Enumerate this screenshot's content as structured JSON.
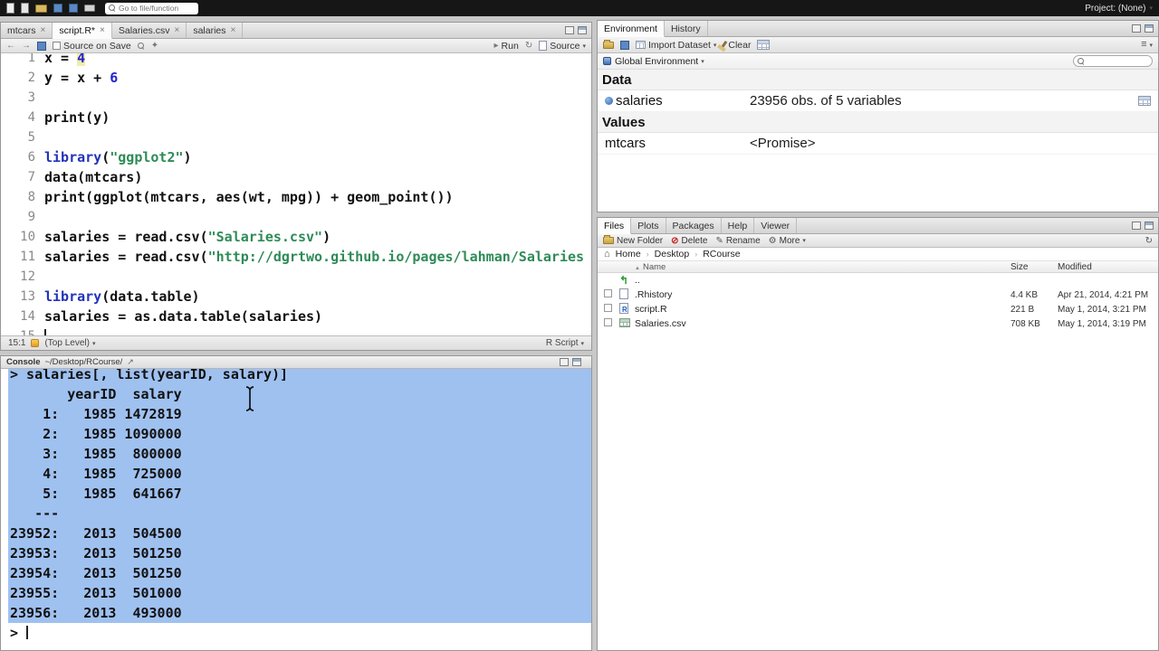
{
  "menubar": {
    "search_placeholder": "Go to file/function",
    "project_label": "Project: (None)"
  },
  "icons": {
    "close": "×",
    "chevron_down": "▾",
    "back_arrow": "←",
    "forward_arrow": "→",
    "run": "▸",
    "rerun": "↻",
    "refresh": "↻",
    "delete": "⊘",
    "rename": "✎",
    "gear": "⚙",
    "home": "⌂",
    "parent_dir": "↰",
    "sort_asc": "▲",
    "popout": "↗",
    "list": "≡",
    "tools": "✦"
  },
  "colors": {
    "selection_blue": "#9fc1f0",
    "syntax_string_green": "#2e8b57",
    "syntax_number_blue": "#2222cc",
    "syntax_keyword_blue": "#2233bb"
  },
  "editor": {
    "tabs": [
      {
        "label": "mtcars"
      },
      {
        "label": "script.R*"
      },
      {
        "label": "Salaries.csv"
      },
      {
        "label": "salaries"
      }
    ],
    "active_tab_index": 1,
    "toolbar": {
      "source_on_save_label": "Source on Save",
      "run_label": "Run",
      "source_label": "Source"
    },
    "lines": [
      {
        "n": "1",
        "segs": [
          [
            "x = ",
            "p"
          ],
          [
            "4",
            "n hl"
          ]
        ]
      },
      {
        "n": "2",
        "segs": [
          [
            "y = x + ",
            "p"
          ],
          [
            "6",
            "n"
          ]
        ]
      },
      {
        "n": "3",
        "segs": []
      },
      {
        "n": "4",
        "segs": [
          [
            "print(y)",
            "p"
          ]
        ]
      },
      {
        "n": "5",
        "segs": []
      },
      {
        "n": "6",
        "segs": [
          [
            "library",
            "k"
          ],
          [
            "(",
            "p"
          ],
          [
            "\"ggplot2\"",
            "s"
          ],
          [
            ")",
            "p"
          ]
        ]
      },
      {
        "n": "7",
        "segs": [
          [
            "data(mtcars)",
            "p"
          ]
        ]
      },
      {
        "n": "8",
        "segs": [
          [
            "print(ggplot(mtcars, aes(wt, mpg)) + geom_point())",
            "p"
          ]
        ]
      },
      {
        "n": "9",
        "segs": []
      },
      {
        "n": "10",
        "segs": [
          [
            "salaries = read.csv(",
            "p"
          ],
          [
            "\"Salaries.csv\"",
            "s"
          ],
          [
            ")",
            "p"
          ]
        ]
      },
      {
        "n": "11",
        "segs": [
          [
            "salaries = read.csv(",
            "p"
          ],
          [
            "\"http://dgrtwo.github.io/pages/lahman/Salaries",
            "s"
          ]
        ]
      },
      {
        "n": "12",
        "segs": []
      },
      {
        "n": "13",
        "segs": [
          [
            "library",
            "k"
          ],
          [
            "(data.table)",
            "p"
          ]
        ]
      },
      {
        "n": "14",
        "segs": [
          [
            "salaries = as.data.table(salaries)",
            "p"
          ]
        ]
      },
      {
        "n": "15",
        "segs": [],
        "caret": true
      }
    ],
    "status": {
      "position": "15:1",
      "scope": "(Top Level)",
      "doc_type": "R Script"
    }
  },
  "console": {
    "title": "Console",
    "path": "~/Desktop/RCourse/",
    "selected_lines": [
      "> salaries[, list(yearID, salary)]",
      "       yearID  salary",
      "    1:   1985 1472819",
      "    2:   1985 1090000",
      "    3:   1985  800000",
      "    4:   1985  725000",
      "    5:   1985  641667",
      "   ---",
      "23952:   2013  504500",
      "23953:   2013  501250",
      "23954:   2013  501250",
      "23955:   2013  501000",
      "23956:   2013  493000"
    ],
    "prompt": "> "
  },
  "environment": {
    "tabs": [
      {
        "label": "Environment"
      },
      {
        "label": "History"
      }
    ],
    "active_tab_index": 0,
    "toolbar": {
      "import_label": "Import Dataset",
      "clear_label": "Clear"
    },
    "scope_selector": "Global Environment",
    "sections": [
      {
        "title": "Data",
        "items": [
          {
            "name": "salaries",
            "value": "23956 obs. of 5 variables",
            "has_view_icon": true
          }
        ]
      },
      {
        "title": "Values",
        "items": [
          {
            "name": "mtcars",
            "value": "<Promise>"
          }
        ]
      }
    ]
  },
  "files": {
    "tabs": [
      {
        "label": "Files"
      },
      {
        "label": "Plots"
      },
      {
        "label": "Packages"
      },
      {
        "label": "Help"
      },
      {
        "label": "Viewer"
      }
    ],
    "active_tab_index": 0,
    "toolbar": {
      "new_folder": "New Folder",
      "delete": "Delete",
      "rename": "Rename",
      "more": "More"
    },
    "breadcrumb": [
      "Home",
      "Desktop",
      "RCourse"
    ],
    "columns": {
      "name": "Name",
      "size": "Size",
      "modified": "Modified"
    },
    "rows": [
      {
        "name": "..",
        "size": "",
        "modified": "",
        "icon": "up"
      },
      {
        "name": ".Rhistory",
        "size": "4.4 KB",
        "modified": "Apr 21, 2014, 4:21 PM",
        "icon": "file"
      },
      {
        "name": "script.R",
        "size": "221 B",
        "modified": "May 1, 2014, 3:21 PM",
        "icon": "file-r"
      },
      {
        "name": "Salaries.csv",
        "size": "708 KB",
        "modified": "May 1, 2014, 3:19 PM",
        "icon": "table"
      }
    ]
  }
}
